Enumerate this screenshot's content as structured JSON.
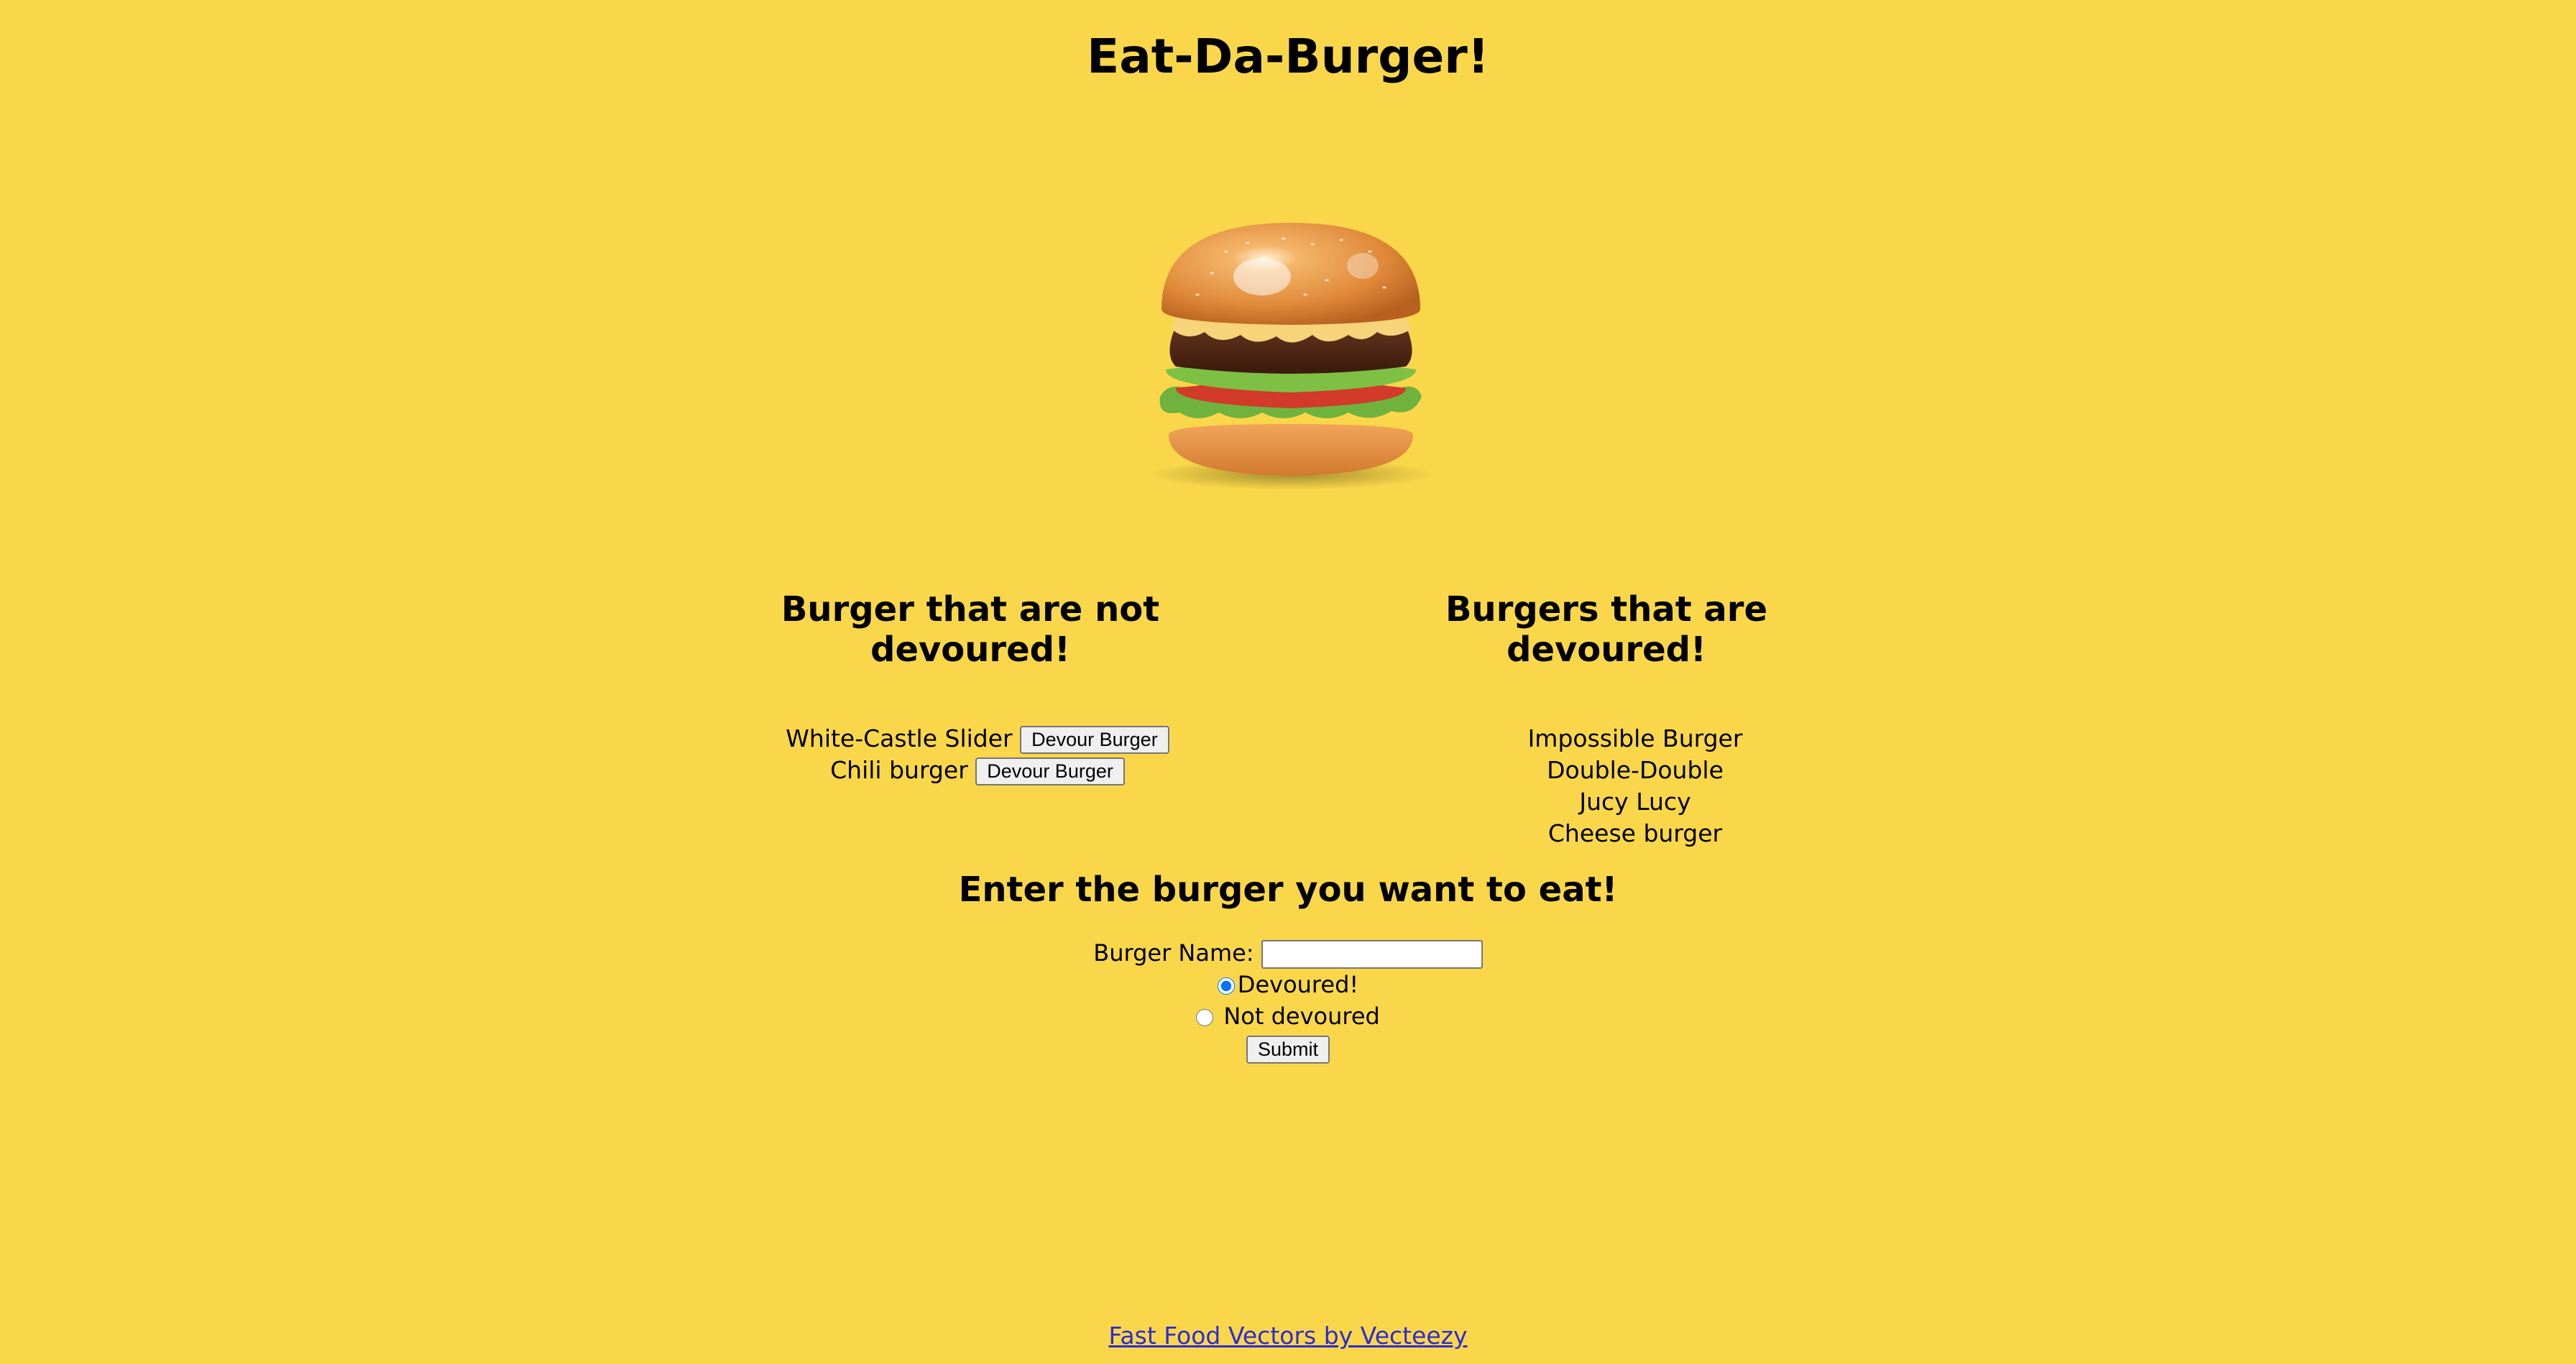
{
  "page": {
    "title": "Eat-Da-Burger!"
  },
  "hero": {
    "image_icon": "burger-illustration"
  },
  "not_devoured": {
    "heading": "Burger that are not devoured!",
    "items": [
      {
        "name": "White-Castle Slider",
        "button": "Devour Burger"
      },
      {
        "name": "Chili burger",
        "button": "Devour Burger"
      }
    ]
  },
  "devoured": {
    "heading": "Burgers that are devoured!",
    "items": [
      {
        "name": "Impossible Burger"
      },
      {
        "name": "Double-Double"
      },
      {
        "name": "Jucy Lucy"
      },
      {
        "name": "Cheese burger"
      }
    ]
  },
  "form": {
    "heading": "Enter the burger you want to eat!",
    "burger_name_label": "Burger Name:",
    "burger_name_value": "",
    "radio_devoured_label": "Devoured!",
    "radio_devoured_checked": true,
    "radio_not_devoured_label": "Not devoured",
    "radio_not_devoured_checked": false,
    "submit_label": "Submit"
  },
  "footer": {
    "link_text": "Fast Food Vectors by Vecteezy"
  },
  "colors": {
    "background": "#fad74a",
    "link": "#2b2bd3"
  }
}
